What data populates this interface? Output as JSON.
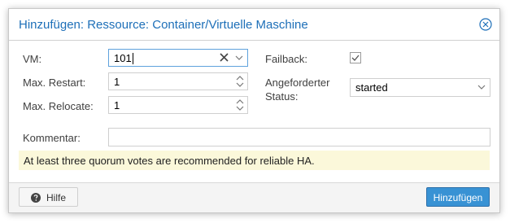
{
  "dialog": {
    "title": "Hinzufügen: Ressource: Container/Virtuelle Maschine"
  },
  "form": {
    "vm": {
      "label": "VM:",
      "value": "101"
    },
    "max_restart": {
      "label": "Max. Restart:",
      "value": "1"
    },
    "max_relocate": {
      "label": "Max. Relocate:",
      "value": "1"
    },
    "failback": {
      "label": "Failback:",
      "checked": true
    },
    "requested_status": {
      "label_line1": "Angeforderter",
      "label_line2": "Status:",
      "value": "started"
    },
    "comment": {
      "label": "Kommentar:",
      "value": ""
    }
  },
  "info": {
    "message": "At least three quorum votes are recommended for reliable HA."
  },
  "footer": {
    "help_label": "Hilfe",
    "add_label": "Hinzufügen"
  },
  "colors": {
    "accent": "#1d6fb8",
    "primary_button": "#3892d4",
    "info_background": "#fbf8da",
    "focus_border": "#5fa2dd"
  },
  "icons": {
    "close": "close-circle-icon",
    "clear": "clear-x-icon",
    "dropdown": "chevron-down-icon",
    "spinner": "spinner-arrows-icon",
    "checkbox": "check-icon",
    "help": "help-question-icon"
  }
}
